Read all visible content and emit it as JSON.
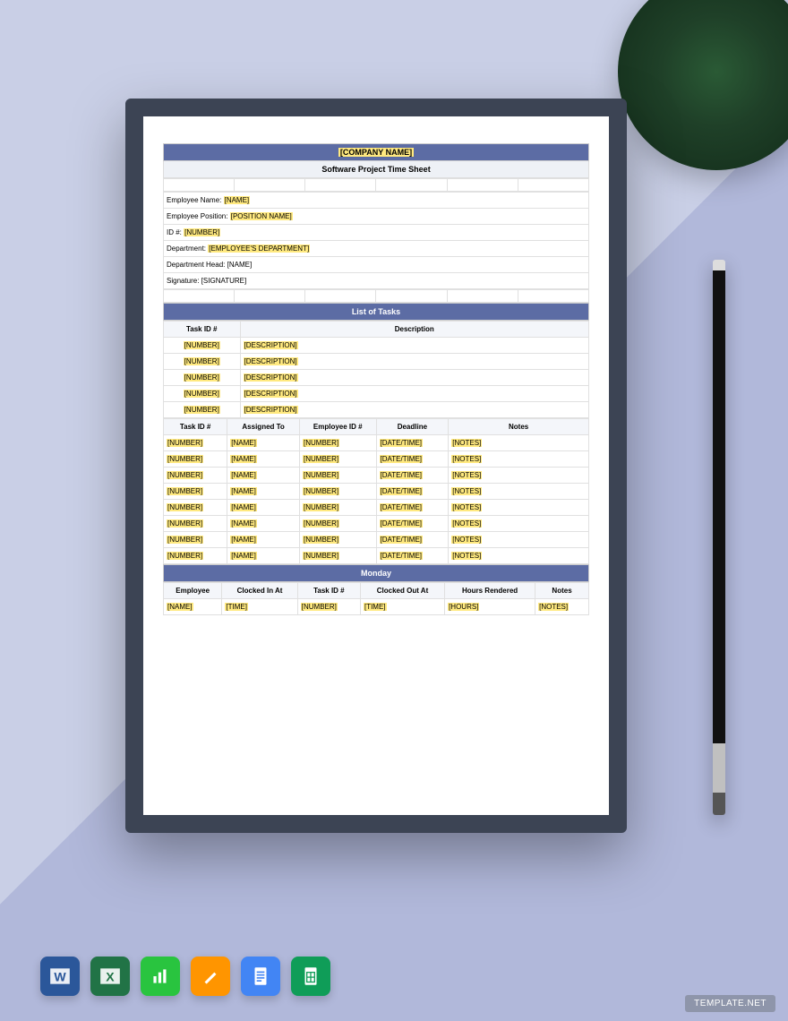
{
  "header": {
    "company": "[COMPANY NAME]",
    "title": "Software Project Time Sheet"
  },
  "employee": {
    "name_label": "Employee Name:",
    "name_value": "[NAME]",
    "position_label": "Employee Position:",
    "position_value": "[POSITION NAME]",
    "id_label": "ID #:",
    "id_value": "[NUMBER]",
    "dept_label": "Department:",
    "dept_value": "[EMPLOYEE'S DEPARTMENT]",
    "head_label": "Department Head:",
    "head_value": "[NAME]",
    "sig_label": "Signature:",
    "sig_value": "[SIGNATURE]"
  },
  "tasks": {
    "title": "List of Tasks",
    "col_id": "Task ID #",
    "col_desc": "Description",
    "rows": [
      {
        "id": "[NUMBER]",
        "desc": "[DESCRIPTION]"
      },
      {
        "id": "[NUMBER]",
        "desc": "[DESCRIPTION]"
      },
      {
        "id": "[NUMBER]",
        "desc": "[DESCRIPTION]"
      },
      {
        "id": "[NUMBER]",
        "desc": "[DESCRIPTION]"
      },
      {
        "id": "[NUMBER]",
        "desc": "[DESCRIPTION]"
      }
    ]
  },
  "assign": {
    "col_id": "Task ID #",
    "col_to": "Assigned To",
    "col_emp": "Employee ID #",
    "col_dead": "Deadline",
    "col_notes": "Notes",
    "rows": [
      {
        "id": "[NUMBER]",
        "to": "[NAME]",
        "emp": "[NUMBER]",
        "dead": "[DATE/TIME]",
        "notes": "[NOTES]"
      },
      {
        "id": "[NUMBER]",
        "to": "[NAME]",
        "emp": "[NUMBER]",
        "dead": "[DATE/TIME]",
        "notes": "[NOTES]"
      },
      {
        "id": "[NUMBER]",
        "to": "[NAME]",
        "emp": "[NUMBER]",
        "dead": "[DATE/TIME]",
        "notes": "[NOTES]"
      },
      {
        "id": "[NUMBER]",
        "to": "[NAME]",
        "emp": "[NUMBER]",
        "dead": "[DATE/TIME]",
        "notes": "[NOTES]"
      },
      {
        "id": "[NUMBER]",
        "to": "[NAME]",
        "emp": "[NUMBER]",
        "dead": "[DATE/TIME]",
        "notes": "[NOTES]"
      },
      {
        "id": "[NUMBER]",
        "to": "[NAME]",
        "emp": "[NUMBER]",
        "dead": "[DATE/TIME]",
        "notes": "[NOTES]"
      },
      {
        "id": "[NUMBER]",
        "to": "[NAME]",
        "emp": "[NUMBER]",
        "dead": "[DATE/TIME]",
        "notes": "[NOTES]"
      },
      {
        "id": "[NUMBER]",
        "to": "[NAME]",
        "emp": "[NUMBER]",
        "dead": "[DATE/TIME]",
        "notes": "[NOTES]"
      }
    ]
  },
  "day": {
    "title": "Monday",
    "col_emp": "Employee",
    "col_in": "Clocked In At",
    "col_id": "Task ID #",
    "col_out": "Clocked Out At",
    "col_hours": "Hours Rendered",
    "col_notes": "Notes",
    "rows": [
      {
        "emp": "[NAME]",
        "in": "[TIME]",
        "id": "[NUMBER]",
        "out": "[TIME]",
        "hours": "[HOURS]",
        "notes": "[NOTES]"
      }
    ]
  },
  "apps": {
    "word": "W",
    "excel": "X",
    "numbers": "N",
    "pages": "P",
    "docs": "D",
    "sheets": "S"
  },
  "watermark": "TEMPLATE.NET"
}
